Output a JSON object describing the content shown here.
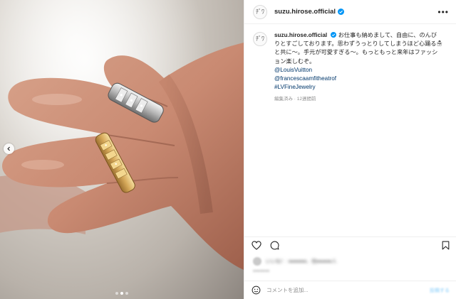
{
  "post": {
    "image_description_icon": "photo-carousel",
    "carousel": {
      "total": 3,
      "current": 2
    }
  },
  "header": {
    "username": "suzu.hirose.official",
    "avatar_mark": "ﾁﾞﾜ",
    "more_icon": "more-horizontal-icon"
  },
  "caption": {
    "username": "suzu.hirose.official",
    "text": "お仕事も納めまして、自由に、のんびりとすごしております。思わずうっとりしてしまうほど心踊る☃と共に〜。手元が可愛すぎる〜。もっともっと来年はファッション楽しむぞ。",
    "links": [
      "@LouisVuitton",
      "@francescaamfitheatrof",
      "#LVFineJewelry"
    ],
    "meta": "編集済み · 12週間前"
  },
  "actions": {
    "like_icon": "heart-icon",
    "comment_icon": "comment-icon",
    "bookmark_icon": "bookmark-icon"
  },
  "likes": {
    "text": "いいね！: ●●●●●●、他●●●●●人"
  },
  "comment_bar": {
    "emoji_icon": "emoji-icon",
    "placeholder": "コメントを追加...",
    "post_label": "投稿する"
  },
  "colors": {
    "text": "#262626",
    "secondary": "#8e8e8e",
    "link": "#00376b",
    "verified": "#0095f6",
    "border": "#efefef"
  }
}
